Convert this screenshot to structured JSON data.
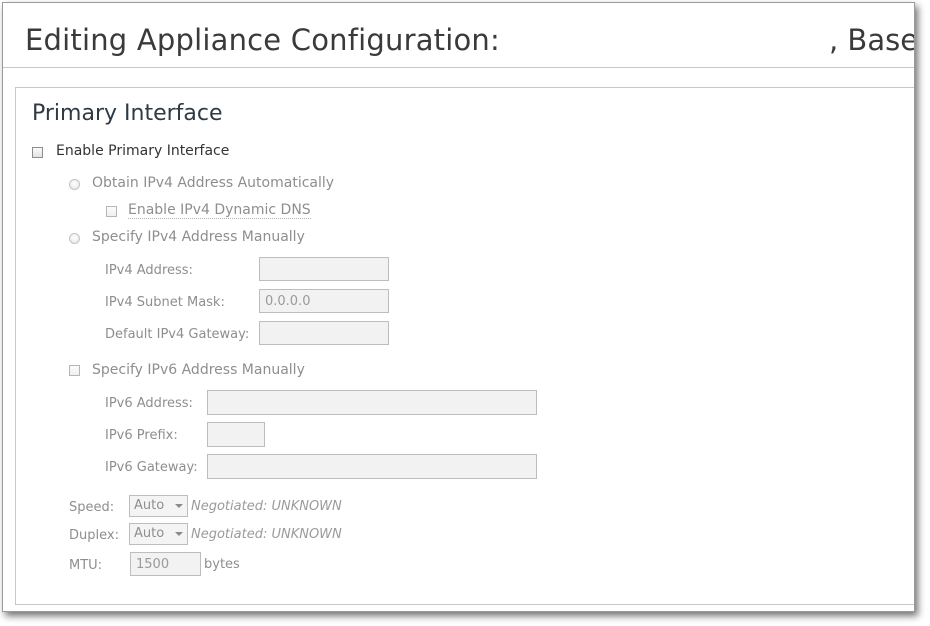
{
  "header": {
    "title": "Editing Appliance Configuration:",
    "title_suffix": ", Base"
  },
  "primary_interface": {
    "section_title": "Primary Interface",
    "enable_label": "Enable Primary Interface",
    "enable_checked": false,
    "ipv4_auto_label": "Obtain IPv4 Address Automatically",
    "ipv4_dynamic_dns_label": "Enable IPv4 Dynamic DNS",
    "ipv4_manual_label": "Specify IPv4 Address Manually",
    "ipv4_address_label": "IPv4 Address:",
    "ipv4_address_value": "",
    "ipv4_subnet_label": "IPv4 Subnet Mask:",
    "ipv4_subnet_value": "0.0.0.0",
    "ipv4_gateway_label": "Default IPv4 Gateway:",
    "ipv4_gateway_value": "",
    "ipv6_manual_label": "Specify IPv6 Address Manually",
    "ipv6_address_label": "IPv6 Address:",
    "ipv6_address_value": "",
    "ipv6_prefix_label": "IPv6 Prefix:",
    "ipv6_prefix_value": "",
    "ipv6_gateway_label": "IPv6 Gateway:",
    "ipv6_gateway_value": "",
    "speed_label": "Speed:",
    "speed_value": "Auto",
    "speed_negotiated": "Negotiated: UNKNOWN",
    "duplex_label": "Duplex:",
    "duplex_value": "Auto",
    "duplex_negotiated": "Negotiated: UNKNOWN",
    "mtu_label": "MTU:",
    "mtu_value": "1500",
    "mtu_unit": "bytes"
  }
}
